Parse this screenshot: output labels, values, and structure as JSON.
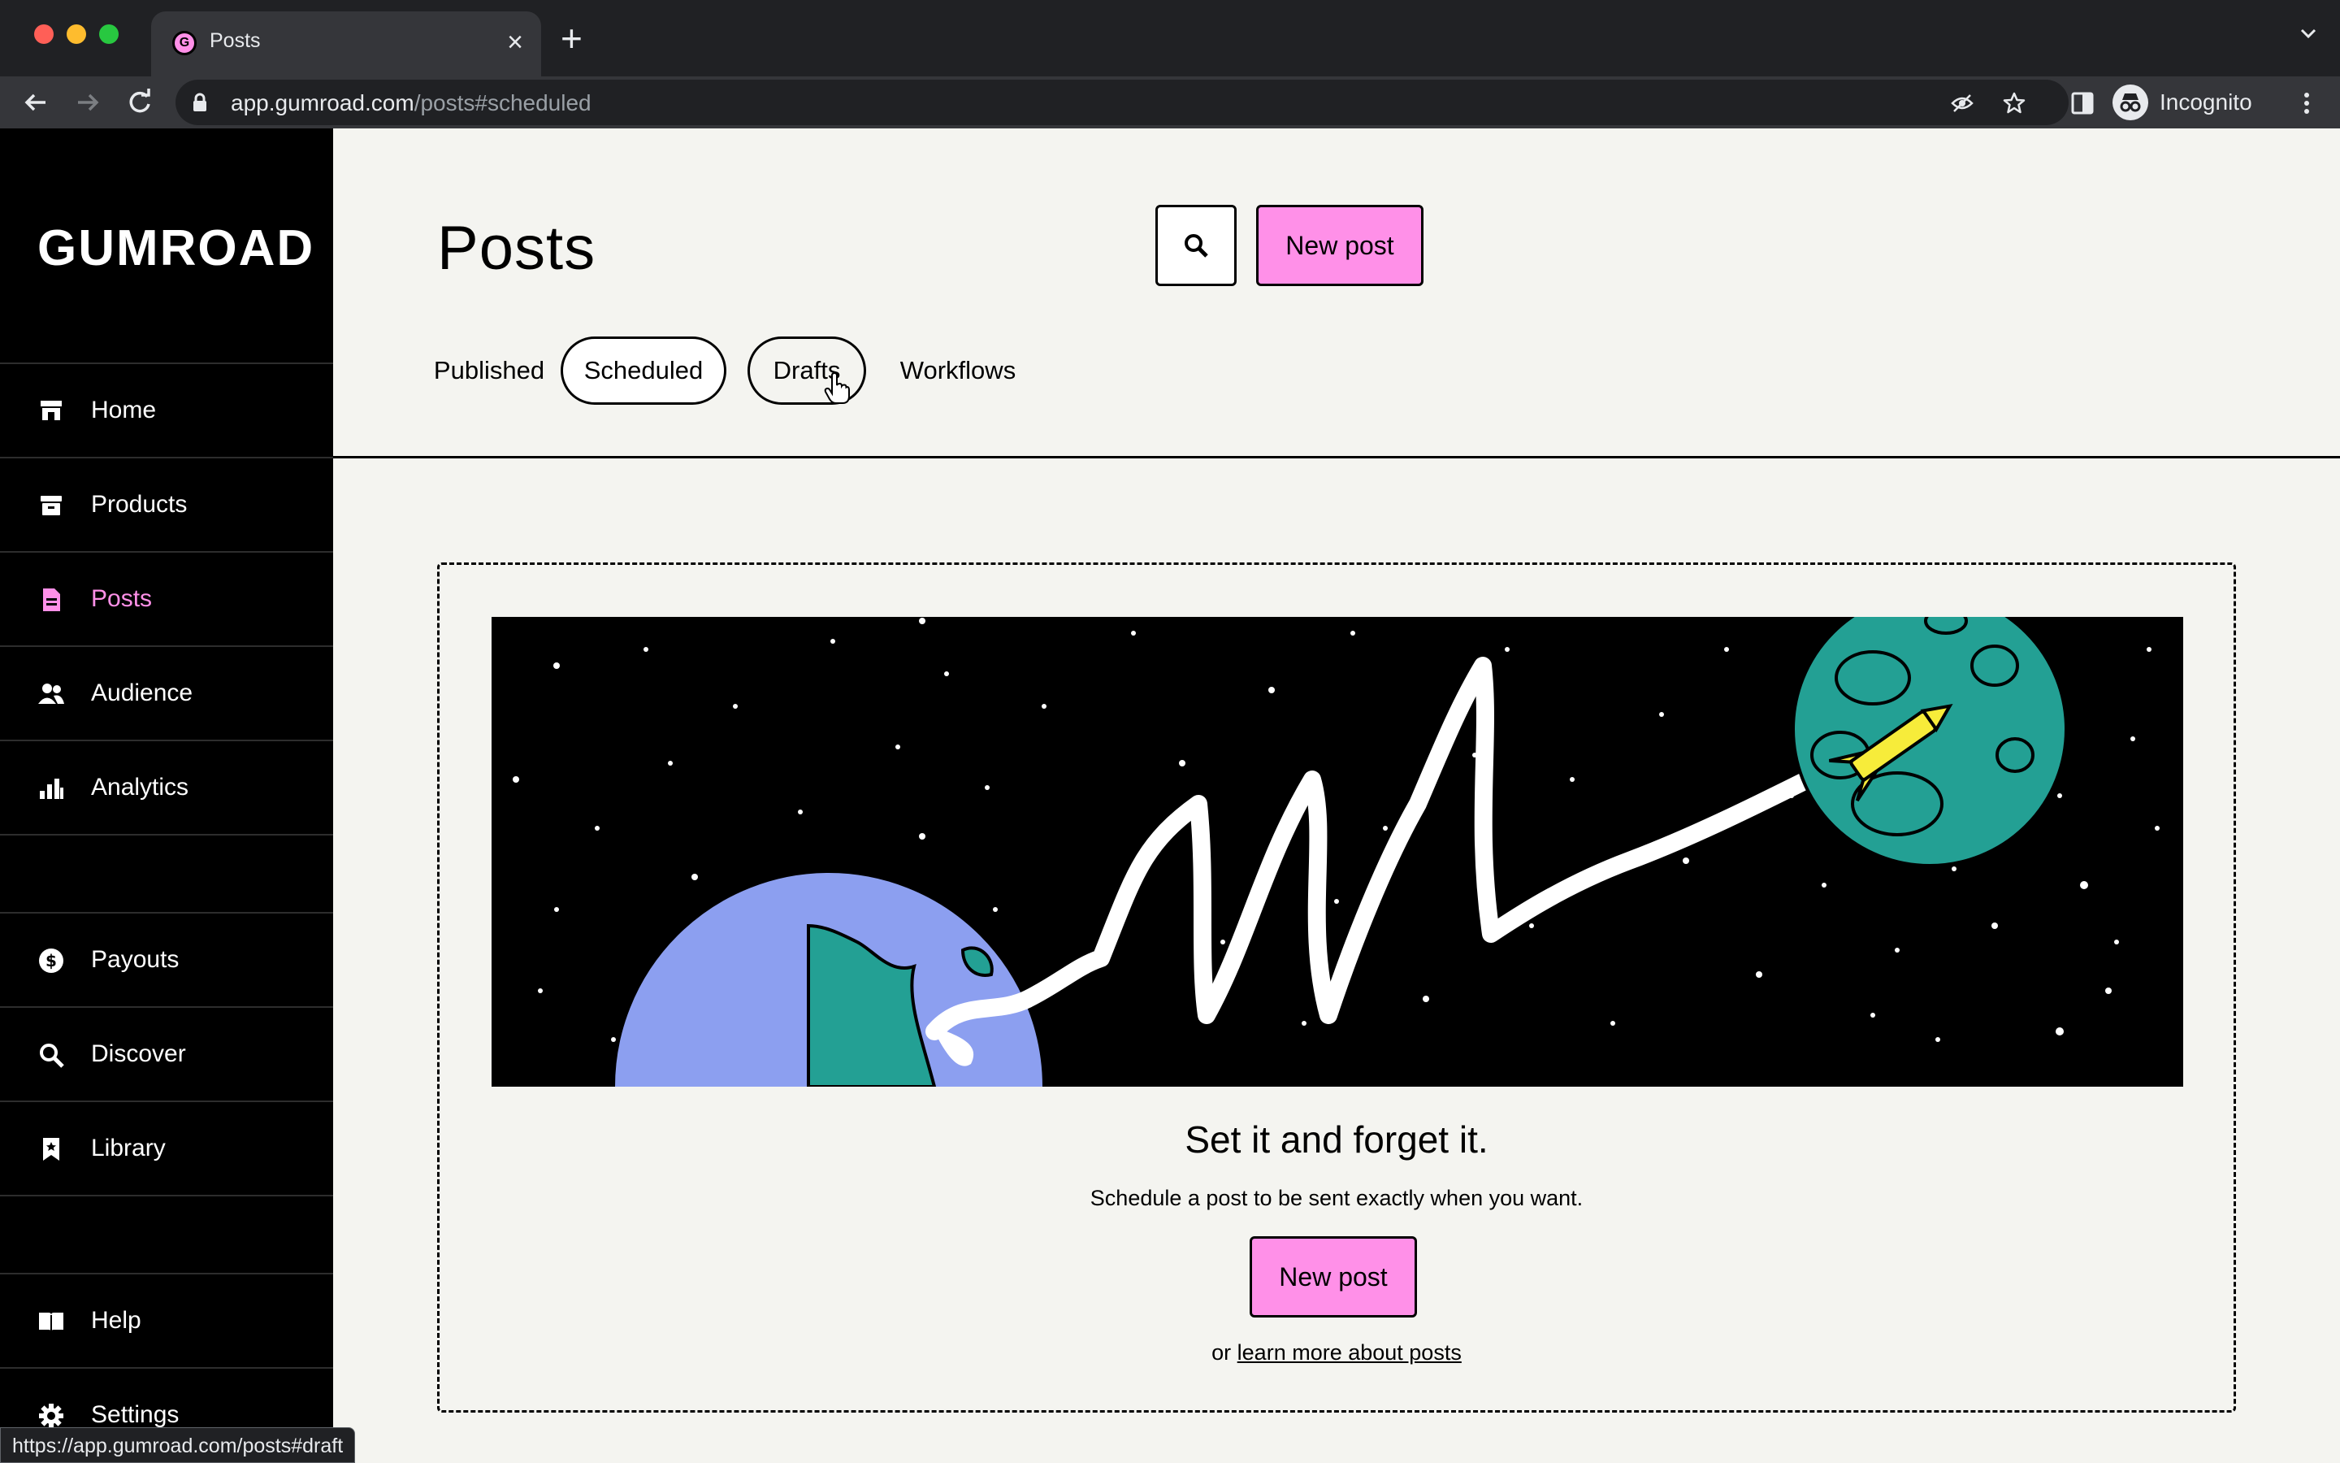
{
  "browser": {
    "tab_title": "Posts",
    "tab_favicon_letter": "G",
    "url_host": "app.gumroad.com",
    "url_path": "/posts#scheduled",
    "profile_label": "Incognito",
    "status_url": "https://app.gumroad.com/posts#draft"
  },
  "sidebar": {
    "logo": "GUMROAD",
    "items": [
      {
        "label": "Home",
        "icon": "storefront-icon"
      },
      {
        "label": "Products",
        "icon": "archive-box-icon"
      },
      {
        "label": "Posts",
        "icon": "document-icon",
        "active": true
      },
      {
        "label": "Audience",
        "icon": "people-icon"
      },
      {
        "label": "Analytics",
        "icon": "bar-chart-icon"
      },
      {
        "label": "Payouts",
        "icon": "dollar-circle-icon"
      },
      {
        "label": "Discover",
        "icon": "search-icon"
      },
      {
        "label": "Library",
        "icon": "bookmark-icon"
      },
      {
        "label": "Help",
        "icon": "book-icon"
      },
      {
        "label": "Settings",
        "icon": "gear-icon"
      }
    ]
  },
  "header": {
    "title": "Posts",
    "new_post_label": "New post"
  },
  "tabs": [
    {
      "label": "Published",
      "state": "default"
    },
    {
      "label": "Scheduled",
      "state": "selected"
    },
    {
      "label": "Drafts",
      "state": "hover"
    },
    {
      "label": "Workflows",
      "state": "default"
    }
  ],
  "empty_state": {
    "heading": "Set it and forget it.",
    "description": "Schedule a post to be sent exactly when you want.",
    "button_label": "New post",
    "prefix": "or",
    "link_label": "learn more about posts"
  },
  "colors": {
    "accent_pink": "#ff90e8",
    "sidebar_bg": "#000000",
    "page_bg": "#f4f4f0",
    "earth_blue": "#8c9ff0",
    "earth_green": "#23a094"
  }
}
